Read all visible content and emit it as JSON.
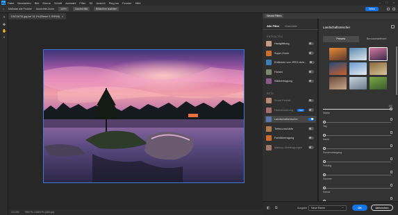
{
  "menubar": {
    "app_icon": "Ps",
    "items": [
      "Datei",
      "Bearbeiten",
      "Bild",
      "Ebene",
      "Schrift",
      "Auswahl",
      "Filter",
      "3D",
      "Ansicht",
      "Plug-ins",
      "Fenster",
      "Hilfe"
    ]
  },
  "options_bar": {
    "checkbox_label": "Maßstab alle Fenster",
    "mode_label": "Ausrichtet-Zoom",
    "zoom_value": "100%",
    "fit_button": "Ganzes Bild",
    "fill_button": "Bildschirm ausfüllen",
    "share_button": "Teilen"
  },
  "document": {
    "tab_title": "DSC04751.jpg bei 13,1% (Ebene 0, RGB/8)",
    "close_icon": "×"
  },
  "status": {
    "zoom": "13,13%",
    "size": "7952 Px x 5304 Px (300 ppi)"
  },
  "neural_filters": {
    "panel_title": "Neural Filters",
    "tabs": [
      "Alle Filter",
      "Warteliste"
    ],
    "active_tab": "Alle Filter",
    "section_enthalten": "ENTHALTEN",
    "section_beta": "BETA",
    "filters_enthalten": [
      {
        "name": "Hautglättung",
        "on": false,
        "color": "#c79a85"
      },
      {
        "name": "Super Zoom",
        "on": false,
        "color": "#c8702c"
      },
      {
        "name": "Entfernen von JPEG-Arte...",
        "on": false,
        "color": "#3a7fb5"
      },
      {
        "name": "Färben",
        "on": false,
        "color": "#7c8a6a"
      },
      {
        "name": "Stilübertragung",
        "on": false,
        "color": "#8a5a8a"
      }
    ],
    "filters_beta": [
      {
        "name": "Smart Portrait",
        "on": false,
        "color": "#b98a76",
        "dim": true
      },
      {
        "name": "Harmonisierung",
        "on": false,
        "color": "#a46d6d",
        "dim": true,
        "badge": "Neu"
      },
      {
        "name": "Landschaftsmischer",
        "on": true,
        "color": "#5a77b0",
        "selected": true
      },
      {
        "name": "Tiefenunschärfe",
        "on": false,
        "color": "#b07a4a"
      },
      {
        "name": "Farbübertragung",
        "on": false,
        "color": "#d06a2a"
      },
      {
        "name": "Makeup-Übertragungen",
        "on": false,
        "color": "#a07868",
        "dim": true
      }
    ]
  },
  "settings": {
    "title": "Landschaftsmischer",
    "tabs": [
      "Presets",
      "Benutzerdefiniert"
    ],
    "active_tab": "Presets",
    "presets": [
      {
        "c1": "#e88a3a",
        "c2": "#5a3a2a"
      },
      {
        "c1": "#5a8ab0",
        "c2": "#dfe6ee"
      },
      {
        "c1": "#d67aa0",
        "c2": "#3a2a4a",
        "selected": true
      },
      {
        "c1": "#2a4a7a",
        "c2": "#c8602a"
      },
      {
        "c1": "#6a9ad0",
        "c2": "#e8ecf0"
      },
      {
        "c1": "#8a6a3a",
        "c2": "#d8c49a"
      },
      {
        "c1": "#6a4a3a",
        "c2": "#c8a88a"
      },
      {
        "c1": "#c8d4e0",
        "c2": "#6a7a8a"
      },
      {
        "c1": "#7aa84a",
        "c2": "#3a5a2a"
      }
    ],
    "sliders": [
      {
        "label": "Stärke",
        "value": "100",
        "level": 1.0,
        "type": "slider"
      },
      {
        "label": "Tag",
        "type": "check"
      },
      {
        "label": "Nacht",
        "type": "check"
      },
      {
        "label": "Sonnenuntergang",
        "type": "check"
      },
      {
        "label": "Frühling",
        "type": "check"
      },
      {
        "label": "Sommer",
        "type": "check"
      },
      {
        "label": "Herbst",
        "type": "check"
      },
      {
        "label": "Winter",
        "type": "check"
      }
    ]
  },
  "footer": {
    "output_label": "Ausgabe",
    "output_value": "Neue Ebene",
    "ok": "OK",
    "cancel": "Abbrechen"
  }
}
